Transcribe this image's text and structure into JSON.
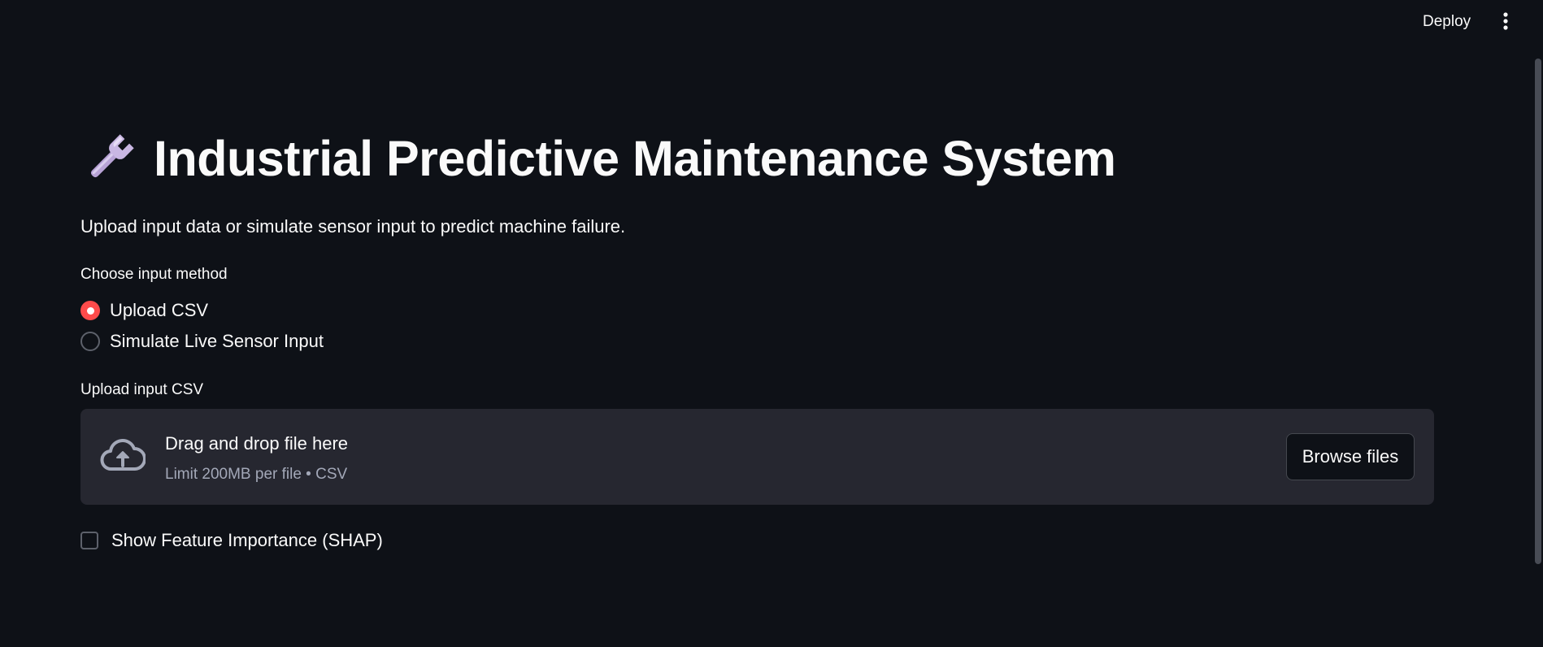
{
  "header": {
    "deploy_label": "Deploy",
    "menu_icon": "vertical-dots-icon"
  },
  "main": {
    "title_icon": "wrench-icon",
    "title": "Industrial Predictive Maintenance System",
    "subtitle": "Upload input data or simulate sensor input to predict machine failure."
  },
  "input_method": {
    "label": "Choose input method",
    "options": [
      {
        "label": "Upload CSV",
        "selected": true
      },
      {
        "label": "Simulate Live Sensor Input",
        "selected": false
      }
    ]
  },
  "uploader": {
    "label": "Upload input CSV",
    "icon": "cloud-upload-icon",
    "drag_text": "Drag and drop file here",
    "limit_text": "Limit 200MB per file • CSV",
    "browse_label": "Browse files"
  },
  "shap_checkbox": {
    "label": "Show Feature Importance (SHAP)",
    "checked": false
  },
  "colors": {
    "background": "#0e1117",
    "accent": "#ff4b4b",
    "dropzone": "#262730",
    "text": "#fafafa",
    "muted_text": "#a3a8b8"
  }
}
